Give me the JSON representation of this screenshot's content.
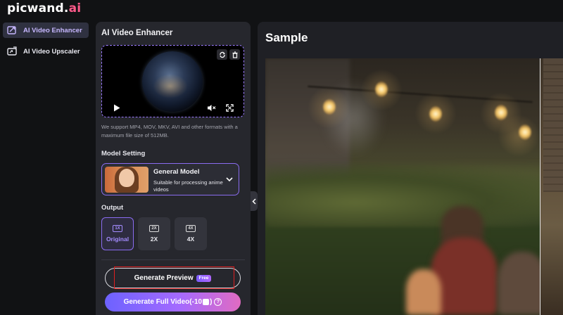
{
  "brand": {
    "name_main": "picwand.",
    "name_accent": "ai"
  },
  "nav": {
    "items": [
      {
        "label": "AI Video Enhancer",
        "icon": "enhance-icon",
        "active": true
      },
      {
        "label": "AI Video Upscaler",
        "icon": "upscale-icon",
        "active": false
      }
    ]
  },
  "panel": {
    "title": "AI Video Enhancer",
    "support_text": "We support MP4, MOV, MKV, AVI and other formats with a maximum file size of 512MB.",
    "model_setting_label": "Model Setting",
    "model": {
      "name": "General Model",
      "description": "Suitable for processing anime videos"
    },
    "output_label": "Output",
    "output_options": [
      {
        "badge": "1X",
        "label": "Original",
        "selected": true
      },
      {
        "badge": "2X",
        "label": "2X",
        "selected": false
      },
      {
        "badge": "4X",
        "label": "4X",
        "selected": false
      }
    ],
    "preview_button": {
      "label": "Generate Preview",
      "badge": "Free"
    },
    "full_button": {
      "label": "Generate Full Video(-10",
      "suffix": ")"
    }
  },
  "sample": {
    "title": "Sample"
  },
  "colors": {
    "accent": "#8a6cf0",
    "brand_accent": "#ff5a8a",
    "highlight": "#e02020"
  }
}
